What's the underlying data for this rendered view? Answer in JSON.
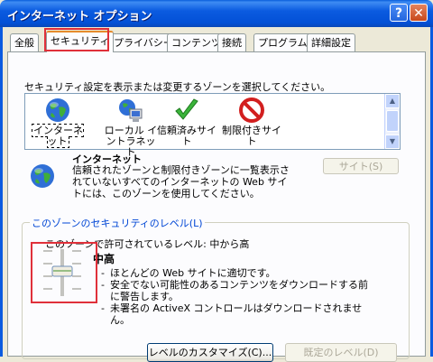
{
  "window": {
    "title": "インターネット オプション",
    "help_glyph": "?",
    "close_glyph": "✕"
  },
  "tabs": [
    {
      "label": "全般"
    },
    {
      "label": "セキュリティ"
    },
    {
      "label": "プライバシー"
    },
    {
      "label": "コンテンツ"
    },
    {
      "label": "接続"
    },
    {
      "label": "プログラム"
    },
    {
      "label": "詳細設定"
    }
  ],
  "security": {
    "instruction": "セキュリティ設定を表示または変更するゾーンを選択してください。",
    "zones": [
      {
        "label": "インターネット",
        "icon": "globe-icon"
      },
      {
        "label": "ローカル イントラネット",
        "icon": "intranet-icon"
      },
      {
        "label": "信頼済みサイト",
        "icon": "checkmark-icon"
      },
      {
        "label": "制限付きサイト",
        "icon": "prohibited-icon"
      }
    ],
    "selected_zone": {
      "title": "インターネット",
      "description": "信頼されたゾーンと制限付きゾーンに一覧表示されていないすべてのインターネットの Web サイトには、このゾーンを使用してください。"
    },
    "sites_button": "サイト(S)",
    "level_group": {
      "legend": "このゾーンのセキュリティのレベル(L)",
      "allowed_text": "このゾーンで許可されているレベル: 中から高",
      "level_name": "中高",
      "bullets": [
        "ほとんどの Web サイトに適切です。",
        "安全でない可能性のあるコンテンツをダウンロードする前に警告します。",
        "未署名の ActiveX コントロールはダウンロードされません。"
      ]
    },
    "custom_level_button": "レベルのカスタマイズ(C)...",
    "default_level_button": "既定のレベル(D)"
  },
  "colors": {
    "titlebar": "#0B5BE0",
    "highlight": "#E0303A",
    "link_legend": "#0046D5"
  }
}
